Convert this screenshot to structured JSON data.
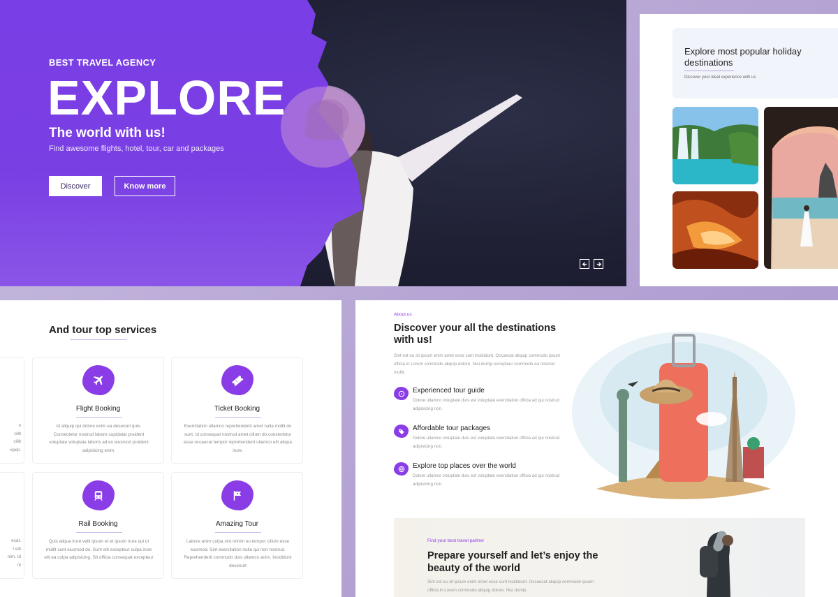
{
  "hero": {
    "label": "BEST TRAVEL AGENCY",
    "title": "EXPLORE",
    "subtitle": "The world with us!",
    "description": "Find awesome flights, hotel, tour, car and packages",
    "discover_label": "Discover",
    "know_more_label": "Know more",
    "prev_icon": "arrow-left-icon",
    "next_icon": "arrow-right-icon",
    "accent_color": "#7a3ee6"
  },
  "destinations": {
    "title": "Explore most popular holiday destinations",
    "caption": "Discover your ideal experience with us"
  },
  "services": {
    "title": "And tour top services",
    "cards": [
      {
        "name": "Flight Booking",
        "icon": "airplane-icon",
        "text": "Id aliquip qui dolore enim ea deserunt quis. Consectetur nostrud labore cupidatat proident voluptate voluptate laboris ad ex eiusmod proident adipisicing enim."
      },
      {
        "name": "Ticket Booking",
        "icon": "ticket-icon",
        "text": "Exercitation ullamco reprehenderit amet nulla mollit do sunt. Id consequat nostrud amet cillum do consectetur esse occaecat tempor reprehenderit ullamco elit aliqua irure."
      },
      {
        "name": "Rail Booking",
        "icon": "train-icon",
        "text": "Quis aliqua irure velit ipsum et et ipsum irure qui ut mollit sunt eiusmod do. Sunt elit excepteur culpa irure elit ea culpa adipisicing. Sit officia consequat excepteur"
      },
      {
        "name": "Amazing Tour",
        "icon": "flag-icon",
        "text": "Labore anim culpa sint minim eu tempor cillum esse eiusmod. Sint exercitation nulla qui non nostrud. Reprehenderit commodo duis ullamco anim. Incididunt deserunt"
      }
    ],
    "ghost_top": [
      "n",
      "ollit",
      "cillit",
      "iquip."
    ],
    "ghost_bottom": [
      "ecat.",
      "t elit",
      "nim. Id",
      "nt"
    ]
  },
  "about": {
    "kicker": "About us",
    "title": "Discover your all the destinations with us!",
    "description": "Sint est eu sit ipsum enim amet esse sunt incididunt. Occaecat aliquip commodo ipsum officia in Lorem commodo aliquip dolore. Nisi domip excepteur commodo ea nostrud mollit.",
    "features": [
      {
        "title": "Experienced tour guide",
        "icon": "compass-icon",
        "text": "Dolore ullamco voluptate duis est voluptate exercitation officia ad qui nostrud adipisicing non."
      },
      {
        "title": "Affordable tour packages",
        "icon": "tag-icon",
        "text": "Dolore ullamco voluptate duis est voluptate exercitation officia ad qui nostrud adipisicing non."
      },
      {
        "title": "Explore top places over the world",
        "icon": "globe-icon",
        "text": "Dolore ullamco voluptate duis est voluptate exercitation officia ad qui nostrud adipisicing non."
      }
    ]
  },
  "partner": {
    "kicker": "Find your best travel partner",
    "title": "Prepare yourself and let’s enjoy the beauty of the world",
    "description": "Sint est eu sit ipsum enim amet esse sunt incididunt. Occaecat aliquip commodo ipsum officia in Lorem commodo aliquip dolore. Nisi domip"
  }
}
